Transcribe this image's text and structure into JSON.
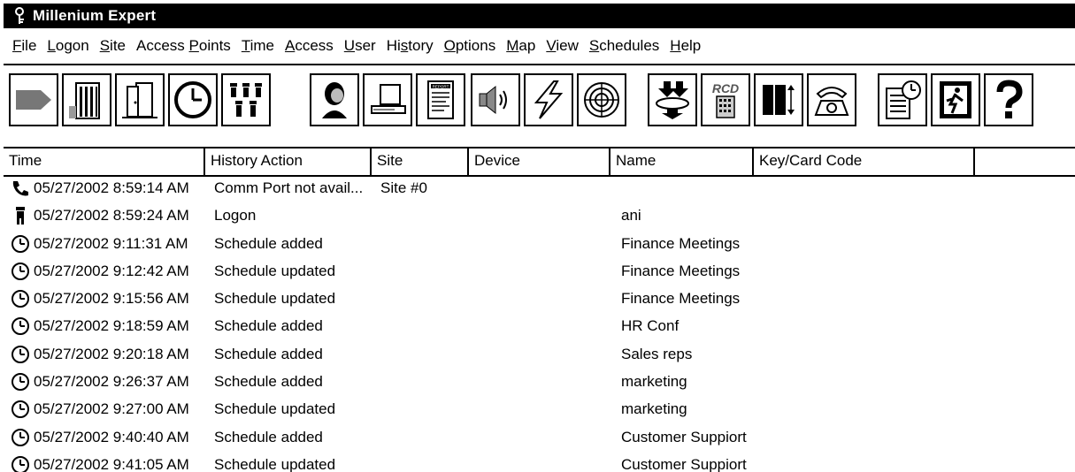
{
  "app": {
    "title": "Millenium Expert"
  },
  "menu": [
    {
      "pre": "",
      "u": "F",
      "post": "ile"
    },
    {
      "pre": "",
      "u": "L",
      "post": "ogon"
    },
    {
      "pre": "",
      "u": "S",
      "post": "ite"
    },
    {
      "pre": "Access ",
      "u": "P",
      "post": "oints"
    },
    {
      "pre": "",
      "u": "T",
      "post": "ime"
    },
    {
      "pre": "",
      "u": "A",
      "post": "ccess"
    },
    {
      "pre": "",
      "u": "U",
      "post": "ser"
    },
    {
      "pre": "Hi",
      "u": "s",
      "post": "tory"
    },
    {
      "pre": "",
      "u": "O",
      "post": "ptions"
    },
    {
      "pre": "",
      "u": "M",
      "post": "ap"
    },
    {
      "pre": "",
      "u": "V",
      "post": "iew"
    },
    {
      "pre": "",
      "u": "S",
      "post": "chedules"
    },
    {
      "pre": "",
      "u": "H",
      "post": "elp"
    }
  ],
  "toolbar": {
    "buttons": [
      "sites",
      "building",
      "door",
      "clock",
      "users",
      "user-profile",
      "computer",
      "report",
      "speaker",
      "lightning",
      "target",
      "download",
      "rcd",
      "panel",
      "phone",
      "schedule-list",
      "exit",
      "help"
    ],
    "rcd_label": "RCD",
    "report_label": "REPORT"
  },
  "table": {
    "columns": [
      "Time",
      "History Action",
      "Site",
      "Device",
      "Name",
      "Key/Card Code"
    ],
    "rows": [
      {
        "icon": "phone-icon",
        "time": "05/27/2002 8:59:14 AM",
        "action": "Comm Port not avail...",
        "site": "Site #0",
        "device": "",
        "name": "",
        "code": ""
      },
      {
        "icon": "person-icon",
        "time": "05/27/2002 8:59:24 AM",
        "action": "Logon",
        "site": "",
        "device": "",
        "name": "ani",
        "code": ""
      },
      {
        "icon": "clock-icon",
        "time": "05/27/2002 9:11:31 AM",
        "action": "Schedule added",
        "site": "",
        "device": "",
        "name": "Finance Meetings",
        "code": ""
      },
      {
        "icon": "clock-icon",
        "time": "05/27/2002 9:12:42 AM",
        "action": "Schedule updated",
        "site": "",
        "device": "",
        "name": "Finance Meetings",
        "code": ""
      },
      {
        "icon": "clock-icon",
        "time": "05/27/2002 9:15:56 AM",
        "action": "Schedule updated",
        "site": "",
        "device": "",
        "name": "Finance Meetings",
        "code": ""
      },
      {
        "icon": "clock-icon",
        "time": "05/27/2002 9:18:59 AM",
        "action": "Schedule added",
        "site": "",
        "device": "",
        "name": "HR Conf",
        "code": ""
      },
      {
        "icon": "clock-icon",
        "time": "05/27/2002 9:20:18 AM",
        "action": "Schedule added",
        "site": "",
        "device": "",
        "name": "Sales reps",
        "code": ""
      },
      {
        "icon": "clock-icon",
        "time": "05/27/2002 9:26:37 AM",
        "action": "Schedule added",
        "site": "",
        "device": "",
        "name": "marketing",
        "code": ""
      },
      {
        "icon": "clock-icon",
        "time": "05/27/2002 9:27:00 AM",
        "action": "Schedule updated",
        "site": "",
        "device": "",
        "name": "marketing",
        "code": ""
      },
      {
        "icon": "clock-icon",
        "time": "05/27/2002 9:40:40 AM",
        "action": "Schedule added",
        "site": "",
        "device": "",
        "name": "Customer Suppiort",
        "code": ""
      },
      {
        "icon": "clock-icon",
        "time": "05/27/2002 9:41:05 AM",
        "action": "Schedule updated",
        "site": "",
        "device": "",
        "name": "Customer Suppiort",
        "code": ""
      }
    ]
  }
}
